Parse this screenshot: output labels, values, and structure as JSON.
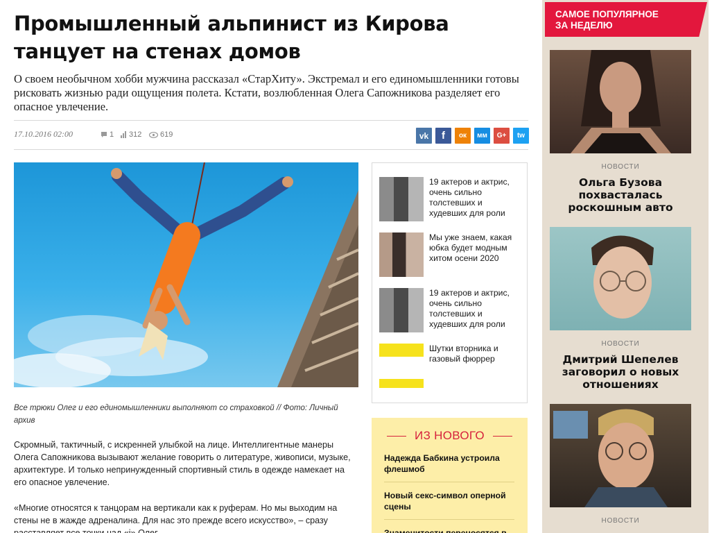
{
  "article": {
    "title": "Промышленный альпинист из Кирова танцует на стенах домов",
    "lead": "О своем необычном хобби мужчина рассказал «СтарХиту». Экстремал и его единомышленники готовы рисковать жизнью ради ощущения полета. Кстати, возлюбленная Олега Сапожникова разделяет его опасное увлечение.",
    "date": "17.10.2016 02:00",
    "comments": "1",
    "ratings": "312",
    "views": "619",
    "caption": "Все трюки Олег и его единомышленники выполняют со страховкой   // Фото: Личный архив",
    "paragraph1": "Скромный, тактичный, с искренней улыбкой на лице. Интеллигентные манеры Олега Сапожникова вызывают желание говорить о литературе, живописи, музыке, архитектуре. И только непринужденный спортивный стиль в одежде намекает на его опасное увлечение.",
    "paragraph2": "«Многие относятся к танцорам на вертикали как к руферам. Но мы выходим на стены не в жажде адреналина. Для нас это прежде всего искусство», – сразу расставляет все точки над «i» Олег."
  },
  "share": {
    "vk": "vk",
    "fb": "f",
    "ok": "ок",
    "mm": "мм",
    "gplus": "G+",
    "tw": "tw",
    "colors": {
      "vk": "#4a76a8",
      "fb": "#3b5998",
      "ok": "#ee8208",
      "mm": "#168de2",
      "gplus": "#dc4e41",
      "tw": "#1da1f2"
    }
  },
  "related": [
    {
      "title": "19 актеров и актрис, очень сильно толстевших и худевших для роли",
      "icon": "actors-collage-thumb"
    },
    {
      "title": "Мы уже знаем, какая юбка будет модным хитом осени 2020",
      "icon": "fashion-thumb"
    },
    {
      "title": "19 актеров и актрис, очень сильно толстевших и худевших для роли",
      "icon": "actors-collage-thumb"
    },
    {
      "title": "Шутки вторника и газовый фюррер",
      "icon": "jokes-thumb"
    }
  ],
  "news": {
    "heading": "ИЗ НОВОГО",
    "items": [
      "Надежда Бабкина устроила флешмоб",
      "Новый секс-символ оперной сцены",
      "Знаменитости переносятся в"
    ]
  },
  "popular": {
    "heading_line1": "САМОЕ ПОПУЛЯРНОЕ",
    "heading_line2": "ЗА НЕДЕЛЮ",
    "items": [
      {
        "kicker": "НОВОСТИ",
        "title": "Ольга Бузова похвасталась роскошным авто"
      },
      {
        "kicker": "НОВОСТИ",
        "title": "Дмитрий Шепелев заговорил о новых отношениях"
      },
      {
        "kicker": "НОВОСТИ",
        "title": ""
      }
    ]
  },
  "colors": {
    "accent": "#e3173d",
    "sidebar_bg": "#e6ddd0",
    "news_bg": "#fdeea8"
  }
}
